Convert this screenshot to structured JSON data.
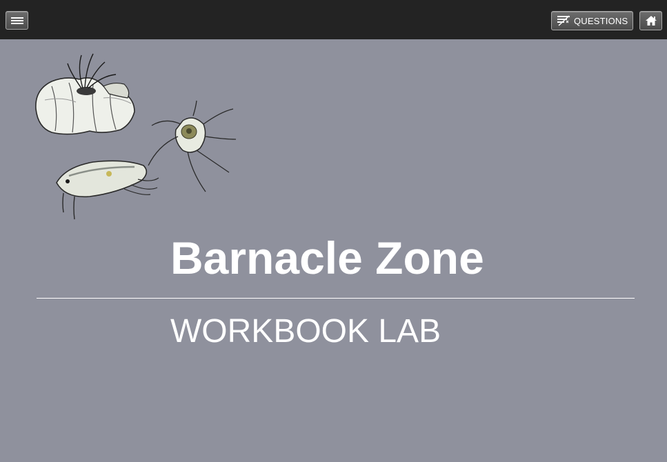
{
  "topbar": {
    "menu_icon": "hamburger-menu-icon",
    "questions_icon": "questions-icon",
    "questions_label": "QUESTIONS",
    "home_icon": "home-icon"
  },
  "main": {
    "title": "Barnacle Zone",
    "subtitle": "WORKBOOK LAB"
  },
  "colors": {
    "background": "#8f919d",
    "topbar": "#232323",
    "button": "#5c5c5c",
    "text": "#ffffff"
  }
}
